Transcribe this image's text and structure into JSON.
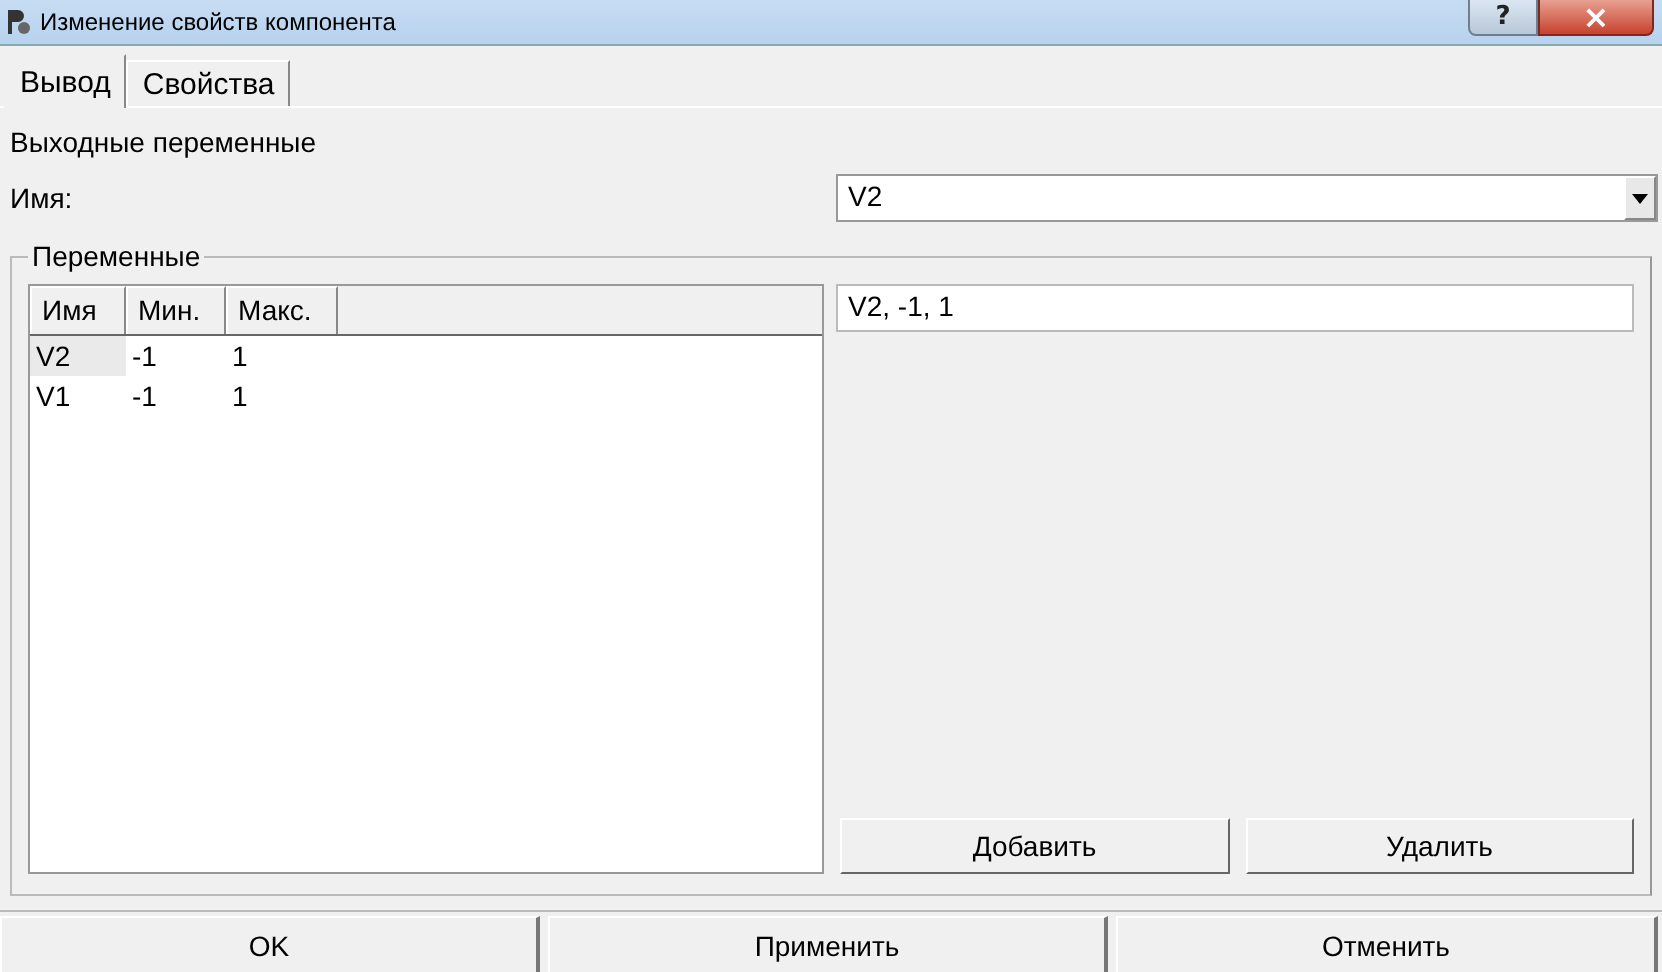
{
  "window": {
    "title": "Изменение свойств компонента",
    "help": "?",
    "close": "×"
  },
  "tabs": [
    {
      "label": "Вывод",
      "selected": true
    },
    {
      "label": "Свойства",
      "selected": false
    }
  ],
  "section_label": "Выходные переменные",
  "name_field": {
    "label": "Имя:",
    "value": "V2"
  },
  "group": {
    "title": "Переменные",
    "table": {
      "columns": [
        "Имя",
        "Мин.",
        "Макс."
      ],
      "rows": [
        {
          "cells": [
            "V2",
            "-1",
            "1"
          ],
          "selected": true
        },
        {
          "cells": [
            "V1",
            "-1",
            "1"
          ],
          "selected": false
        }
      ]
    },
    "entry": {
      "value": "V2, -1, 1"
    },
    "buttons": [
      "Добавить",
      "Удалить"
    ]
  },
  "footer_buttons": [
    "OK",
    "Применить",
    "Отменить"
  ]
}
